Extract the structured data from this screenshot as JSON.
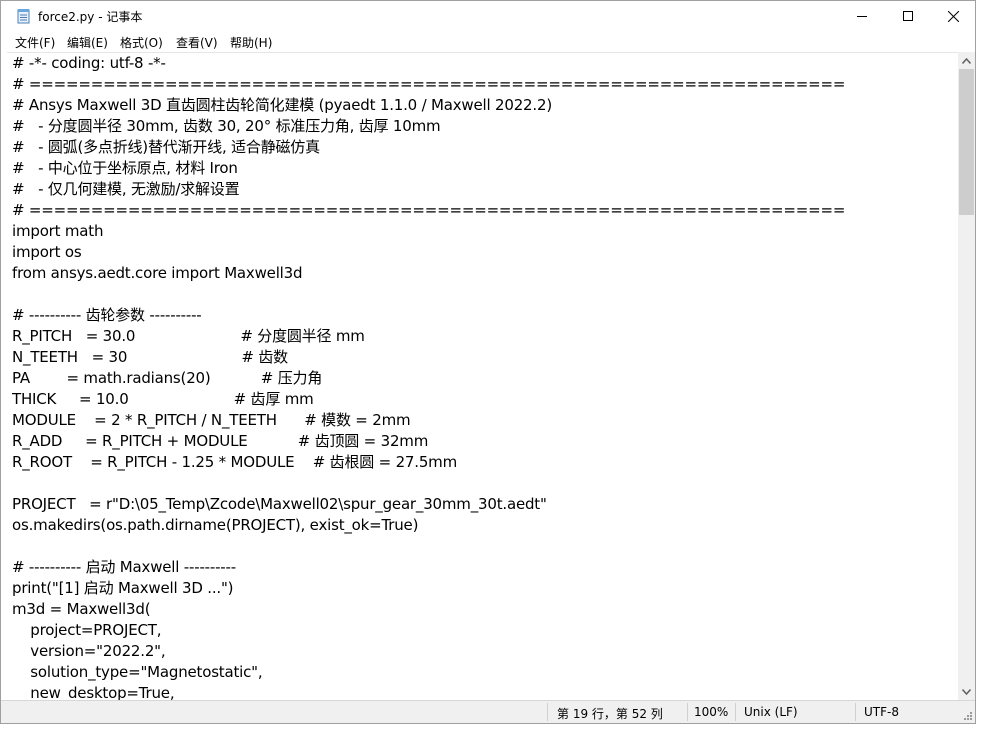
{
  "window": {
    "title": "force2.py - 记事本"
  },
  "menu": [
    "文件(F)",
    "编辑(E)",
    "格式(O)",
    "查看(V)",
    "帮助(H)"
  ],
  "editor": {
    "lines": [
      "# -*- coding: utf-8 -*-",
      "# ==================================================================",
      "# Ansys Maxwell 3D 直齿圆柱齿轮简化建模 (pyaedt 1.1.0 / Maxwell 2022.2)",
      "#   - 分度圆半径 30mm, 齿数 30, 20° 标准压力角, 齿厚 10mm",
      "#   - 圆弧(多点折线)替代渐开线, 适合静磁仿真",
      "#   - 中心位于坐标原点, 材料 Iron",
      "#   - 仅几何建模, 无激励/求解设置",
      "# ==================================================================",
      "import math",
      "import os",
      "from ansys.aedt.core import Maxwell3d",
      "",
      "# ---------- 齿轮参数 ----------",
      "R_PITCH   = 30.0                       # 分度圆半径 mm",
      "N_TEETH   = 30                         # 齿数",
      "PA        = math.radians(20)           # 压力角",
      "THICK     = 10.0                       # 齿厚 mm",
      "MODULE    = 2 * R_PITCH / N_TEETH      # 模数 = 2mm",
      "R_ADD     = R_PITCH + MODULE           # 齿顶圆 = 32mm",
      "R_ROOT    = R_PITCH - 1.25 * MODULE    # 齿根圆 = 27.5mm",
      "",
      "PROJECT   = r\"D:\\05_Temp\\Zcode\\Maxwell02\\spur_gear_30mm_30t.aedt\"",
      "os.makedirs(os.path.dirname(PROJECT), exist_ok=True)",
      "",
      "# ---------- 启动 Maxwell ----------",
      "print(\"[1] 启动 Maxwell 3D ...\")",
      "m3d = Maxwell3d(",
      "    project=PROJECT,",
      "    version=\"2022.2\",",
      "    solution_type=\"Magnetostatic\",",
      "    new_desktop=True,"
    ]
  },
  "status": {
    "position": "第 19 行，第 52 列",
    "zoom": "100%",
    "line_ending": "Unix (LF)",
    "encoding": "UTF-8"
  }
}
